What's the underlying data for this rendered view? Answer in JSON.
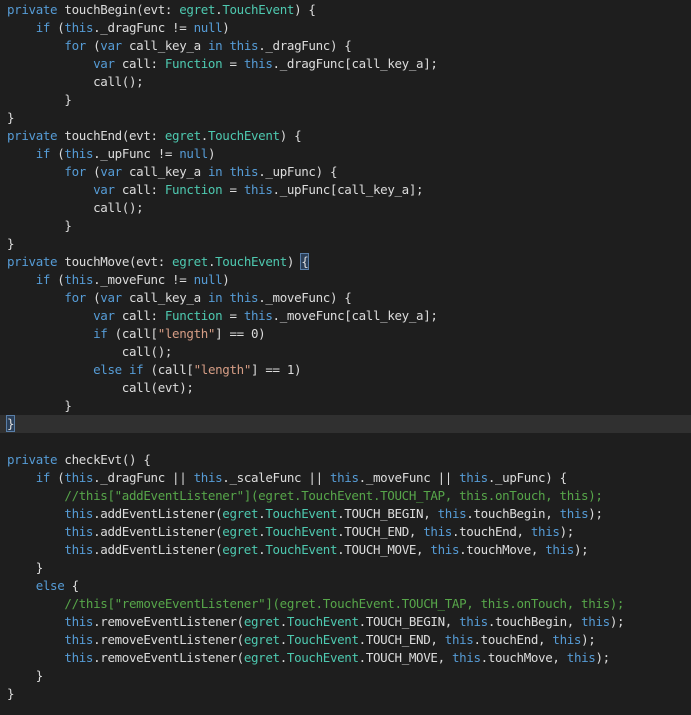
{
  "colors": {
    "keyword": "#569cd6",
    "type": "#4ec9b0",
    "string": "#d69d85",
    "comment": "#57a64a",
    "text": "#dcdcdc",
    "background": "#1e1e1e",
    "highlight": "#303030"
  },
  "highlighted_line": 23,
  "lines": [
    [
      [
        "kw",
        "private"
      ],
      [
        "p",
        " touchBegin(evt: "
      ],
      [
        "ty",
        "egret"
      ],
      [
        "p",
        "."
      ],
      [
        "ty",
        "TouchEvent"
      ],
      [
        "p",
        ") {"
      ]
    ],
    [
      [
        "p",
        "    "
      ],
      [
        "kw",
        "if"
      ],
      [
        "p",
        " ("
      ],
      [
        "kw",
        "this"
      ],
      [
        "p",
        "._dragFunc != "
      ],
      [
        "kw",
        "null"
      ],
      [
        "p",
        ")"
      ]
    ],
    [
      [
        "p",
        "        "
      ],
      [
        "kw",
        "for"
      ],
      [
        "p",
        " ("
      ],
      [
        "kw",
        "var"
      ],
      [
        "p",
        " call_key_a "
      ],
      [
        "kw",
        "in"
      ],
      [
        "p",
        " "
      ],
      [
        "kw",
        "this"
      ],
      [
        "p",
        "._dragFunc) {"
      ]
    ],
    [
      [
        "p",
        "            "
      ],
      [
        "kw",
        "var"
      ],
      [
        "p",
        " call: "
      ],
      [
        "ty",
        "Function"
      ],
      [
        "p",
        " = "
      ],
      [
        "kw",
        "this"
      ],
      [
        "p",
        "._dragFunc[call_key_a];"
      ]
    ],
    [
      [
        "p",
        "            call();"
      ]
    ],
    [
      [
        "p",
        "        }"
      ]
    ],
    [
      [
        "p",
        "}"
      ]
    ],
    [
      [
        "kw",
        "private"
      ],
      [
        "p",
        " touchEnd(evt: "
      ],
      [
        "ty",
        "egret"
      ],
      [
        "p",
        "."
      ],
      [
        "ty",
        "TouchEvent"
      ],
      [
        "p",
        ") {"
      ]
    ],
    [
      [
        "p",
        "    "
      ],
      [
        "kw",
        "if"
      ],
      [
        "p",
        " ("
      ],
      [
        "kw",
        "this"
      ],
      [
        "p",
        "._upFunc != "
      ],
      [
        "kw",
        "null"
      ],
      [
        "p",
        ")"
      ]
    ],
    [
      [
        "p",
        "        "
      ],
      [
        "kw",
        "for"
      ],
      [
        "p",
        " ("
      ],
      [
        "kw",
        "var"
      ],
      [
        "p",
        " call_key_a "
      ],
      [
        "kw",
        "in"
      ],
      [
        "p",
        " "
      ],
      [
        "kw",
        "this"
      ],
      [
        "p",
        "._upFunc) {"
      ]
    ],
    [
      [
        "p",
        "            "
      ],
      [
        "kw",
        "var"
      ],
      [
        "p",
        " call: "
      ],
      [
        "ty",
        "Function"
      ],
      [
        "p",
        " = "
      ],
      [
        "kw",
        "this"
      ],
      [
        "p",
        "._upFunc[call_key_a];"
      ]
    ],
    [
      [
        "p",
        "            call();"
      ]
    ],
    [
      [
        "p",
        "        }"
      ]
    ],
    [
      [
        "p",
        "}"
      ]
    ],
    [
      [
        "kw",
        "private"
      ],
      [
        "p",
        " touchMove(evt: "
      ],
      [
        "ty",
        "egret"
      ],
      [
        "p",
        "."
      ],
      [
        "ty",
        "TouchEvent"
      ],
      [
        "p",
        ") "
      ],
      [
        "bm",
        "{"
      ]
    ],
    [
      [
        "p",
        "    "
      ],
      [
        "kw",
        "if"
      ],
      [
        "p",
        " ("
      ],
      [
        "kw",
        "this"
      ],
      [
        "p",
        "._moveFunc != "
      ],
      [
        "kw",
        "null"
      ],
      [
        "p",
        ")"
      ]
    ],
    [
      [
        "p",
        "        "
      ],
      [
        "kw",
        "for"
      ],
      [
        "p",
        " ("
      ],
      [
        "kw",
        "var"
      ],
      [
        "p",
        " call_key_a "
      ],
      [
        "kw",
        "in"
      ],
      [
        "p",
        " "
      ],
      [
        "kw",
        "this"
      ],
      [
        "p",
        "._moveFunc) {"
      ]
    ],
    [
      [
        "p",
        "            "
      ],
      [
        "kw",
        "var"
      ],
      [
        "p",
        " call: "
      ],
      [
        "ty",
        "Function"
      ],
      [
        "p",
        " = "
      ],
      [
        "kw",
        "this"
      ],
      [
        "p",
        "._moveFunc[call_key_a];"
      ]
    ],
    [
      [
        "p",
        "            "
      ],
      [
        "kw",
        "if"
      ],
      [
        "p",
        " (call["
      ],
      [
        "st",
        "\"length\""
      ],
      [
        "p",
        "] == 0)"
      ]
    ],
    [
      [
        "p",
        "                call();"
      ]
    ],
    [
      [
        "p",
        "            "
      ],
      [
        "kw",
        "else"
      ],
      [
        "p",
        " "
      ],
      [
        "kw",
        "if"
      ],
      [
        "p",
        " (call["
      ],
      [
        "st",
        "\"length\""
      ],
      [
        "p",
        "] == 1)"
      ]
    ],
    [
      [
        "p",
        "                call(evt);"
      ]
    ],
    [
      [
        "p",
        "        }"
      ]
    ],
    [
      [
        "bm",
        "}"
      ]
    ],
    [],
    [
      [
        "kw",
        "private"
      ],
      [
        "p",
        " checkEvt() {"
      ]
    ],
    [
      [
        "p",
        "    "
      ],
      [
        "kw",
        "if"
      ],
      [
        "p",
        " ("
      ],
      [
        "kw",
        "this"
      ],
      [
        "p",
        "._dragFunc || "
      ],
      [
        "kw",
        "this"
      ],
      [
        "p",
        "._scaleFunc || "
      ],
      [
        "kw",
        "this"
      ],
      [
        "p",
        "._moveFunc || "
      ],
      [
        "kw",
        "this"
      ],
      [
        "p",
        "._upFunc) {"
      ]
    ],
    [
      [
        "p",
        "        "
      ],
      [
        "cm",
        "//this[\"addEventListener\"](egret.TouchEvent.TOUCH_TAP, this.onTouch, this);"
      ]
    ],
    [
      [
        "p",
        "        "
      ],
      [
        "kw",
        "this"
      ],
      [
        "p",
        ".addEventListener("
      ],
      [
        "ty",
        "egret"
      ],
      [
        "p",
        "."
      ],
      [
        "ty",
        "TouchEvent"
      ],
      [
        "p",
        ".TOUCH_BEGIN, "
      ],
      [
        "kw",
        "this"
      ],
      [
        "p",
        ".touchBegin, "
      ],
      [
        "kw",
        "this"
      ],
      [
        "p",
        ");"
      ]
    ],
    [
      [
        "p",
        "        "
      ],
      [
        "kw",
        "this"
      ],
      [
        "p",
        ".addEventListener("
      ],
      [
        "ty",
        "egret"
      ],
      [
        "p",
        "."
      ],
      [
        "ty",
        "TouchEvent"
      ],
      [
        "p",
        ".TOUCH_END, "
      ],
      [
        "kw",
        "this"
      ],
      [
        "p",
        ".touchEnd, "
      ],
      [
        "kw",
        "this"
      ],
      [
        "p",
        ");"
      ]
    ],
    [
      [
        "p",
        "        "
      ],
      [
        "kw",
        "this"
      ],
      [
        "p",
        ".addEventListener("
      ],
      [
        "ty",
        "egret"
      ],
      [
        "p",
        "."
      ],
      [
        "ty",
        "TouchEvent"
      ],
      [
        "p",
        ".TOUCH_MOVE, "
      ],
      [
        "kw",
        "this"
      ],
      [
        "p",
        ".touchMove, "
      ],
      [
        "kw",
        "this"
      ],
      [
        "p",
        ");"
      ]
    ],
    [
      [
        "p",
        "    }"
      ]
    ],
    [
      [
        "p",
        "    "
      ],
      [
        "kw",
        "else"
      ],
      [
        "p",
        " {"
      ]
    ],
    [
      [
        "p",
        "        "
      ],
      [
        "cm",
        "//this[\"removeEventListener\"](egret.TouchEvent.TOUCH_TAP, this.onTouch, this);"
      ]
    ],
    [
      [
        "p",
        "        "
      ],
      [
        "kw",
        "this"
      ],
      [
        "p",
        ".removeEventListener("
      ],
      [
        "ty",
        "egret"
      ],
      [
        "p",
        "."
      ],
      [
        "ty",
        "TouchEvent"
      ],
      [
        "p",
        ".TOUCH_BEGIN, "
      ],
      [
        "kw",
        "this"
      ],
      [
        "p",
        ".touchBegin, "
      ],
      [
        "kw",
        "this"
      ],
      [
        "p",
        ");"
      ]
    ],
    [
      [
        "p",
        "        "
      ],
      [
        "kw",
        "this"
      ],
      [
        "p",
        ".removeEventListener("
      ],
      [
        "ty",
        "egret"
      ],
      [
        "p",
        "."
      ],
      [
        "ty",
        "TouchEvent"
      ],
      [
        "p",
        ".TOUCH_END, "
      ],
      [
        "kw",
        "this"
      ],
      [
        "p",
        ".touchEnd, "
      ],
      [
        "kw",
        "this"
      ],
      [
        "p",
        ");"
      ]
    ],
    [
      [
        "p",
        "        "
      ],
      [
        "kw",
        "this"
      ],
      [
        "p",
        ".removeEventListener("
      ],
      [
        "ty",
        "egret"
      ],
      [
        "p",
        "."
      ],
      [
        "ty",
        "TouchEvent"
      ],
      [
        "p",
        ".TOUCH_MOVE, "
      ],
      [
        "kw",
        "this"
      ],
      [
        "p",
        ".touchMove, "
      ],
      [
        "kw",
        "this"
      ],
      [
        "p",
        ");"
      ]
    ],
    [
      [
        "p",
        "    }"
      ]
    ],
    [
      [
        "p",
        "}"
      ]
    ]
  ]
}
